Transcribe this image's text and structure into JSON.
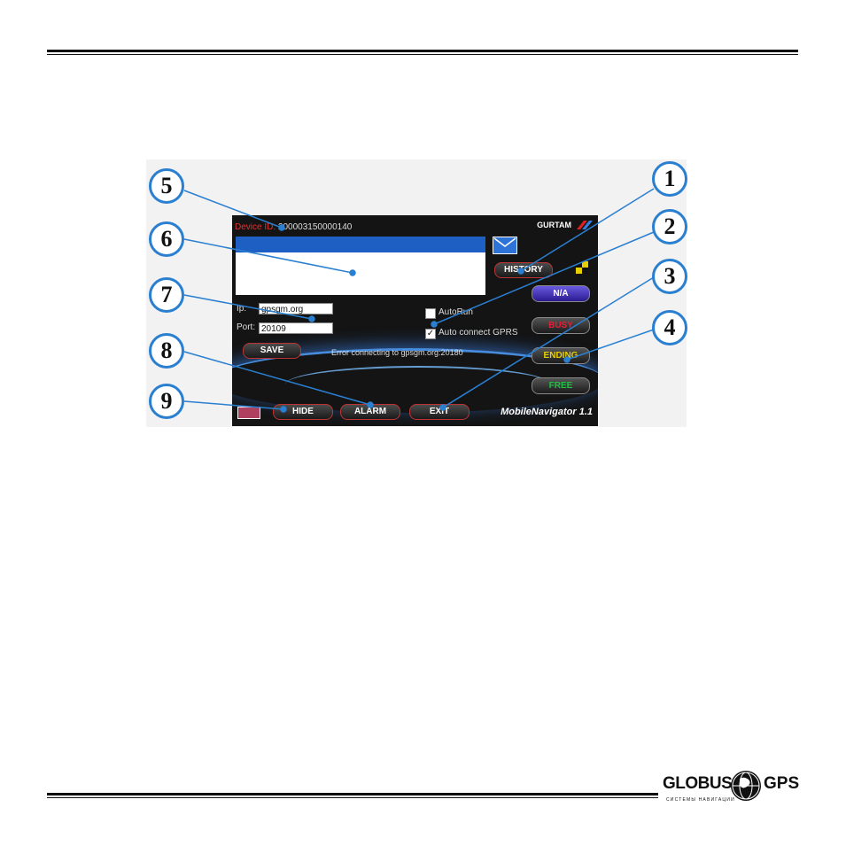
{
  "screen": {
    "device_id_label": "Device ID:",
    "device_id_value": "200003150000140",
    "gurtam": "GURTAM",
    "ip_label": "Ip:",
    "ip_value": "gpsgm.org",
    "port_label": "Port:",
    "port_value": "20109",
    "save_label": "SAVE",
    "history_label": "HISTORY",
    "autorun_label": "AutoRun",
    "autoconnect_label": "Auto connect GPRS",
    "error_text": "Error connecting to gpsgm.org:20180",
    "status_na": "N/A",
    "status_busy": "BUSY",
    "status_ending": "ENDING",
    "status_free": "FREE",
    "hide_label": "HIDE",
    "alarm_label": "ALARM",
    "exit_label": "EXIT",
    "app_name": "MobileNavigator 1.1",
    "colors": {
      "busy": "#e0203a",
      "ending": "#e8d000",
      "free": "#20c040",
      "na": "#ffffff",
      "accent": "#2a7fd0"
    }
  },
  "callouts": [
    "1",
    "2",
    "3",
    "4",
    "5",
    "6",
    "7",
    "8",
    "9"
  ],
  "logo": {
    "word1": "GLOBUS",
    "word2": "GPS",
    "tagline": "СИСТЕМЫ НАВИГАЦИИ"
  }
}
